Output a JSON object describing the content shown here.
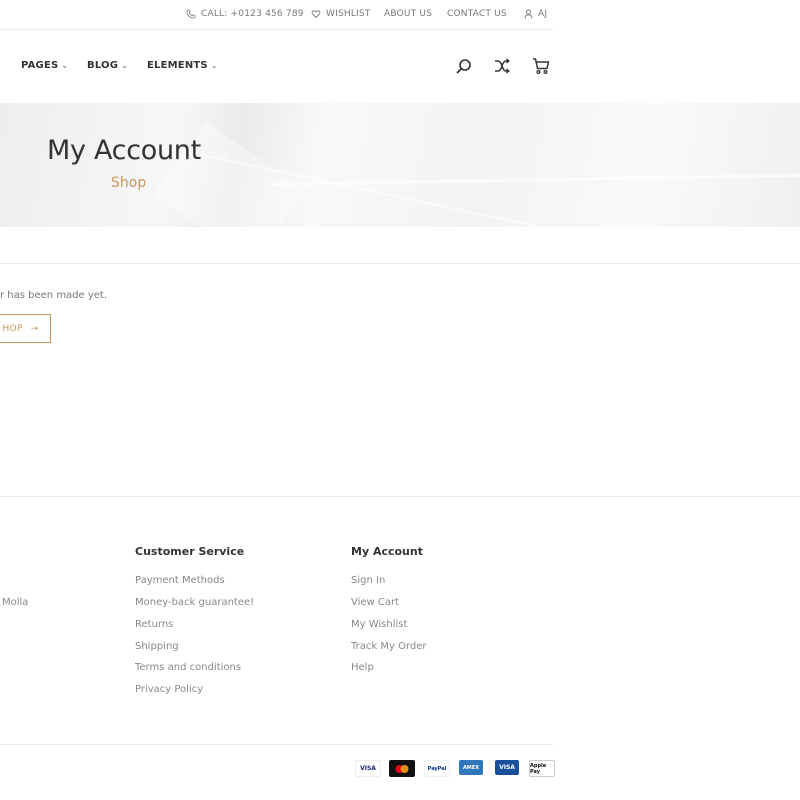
{
  "topbar": {
    "call": "CALL: +0123 456 789",
    "wishlist": "WISHLIST",
    "about": "ABOUT US",
    "contact": "CONTACT US",
    "account": "AJ"
  },
  "nav": {
    "pages": "PAGES",
    "blog": "BLOG",
    "elements": "ELEMENTS"
  },
  "hero": {
    "title": "My Account",
    "subtitle": "Shop"
  },
  "content": {
    "notice": "r has been made yet.",
    "shop_button": "HOP",
    "shop_arrow": "→"
  },
  "footer": {
    "partial_text": "Molla",
    "customer_service": {
      "heading": "Customer Service",
      "links": [
        "Payment Methods",
        "Money-back guarantee!",
        "Returns",
        "Shipping",
        "Terms and conditions",
        "Privacy Policy"
      ]
    },
    "my_account": {
      "heading": "My Account",
      "links": [
        "Sign In",
        "View Cart",
        "My Wishlist",
        "Track My Order",
        "Help"
      ]
    },
    "payments": [
      "VISA",
      "mastercard",
      "PayPal",
      "AMEX",
      "VISA",
      "Apple Pay"
    ]
  },
  "colors": {
    "accent": "#c8965a",
    "text": "#333333",
    "muted": "#888888"
  },
  "icons": [
    "phone-icon",
    "heart-icon",
    "user-icon",
    "search-icon",
    "shuffle-icon",
    "cart-icon"
  ]
}
